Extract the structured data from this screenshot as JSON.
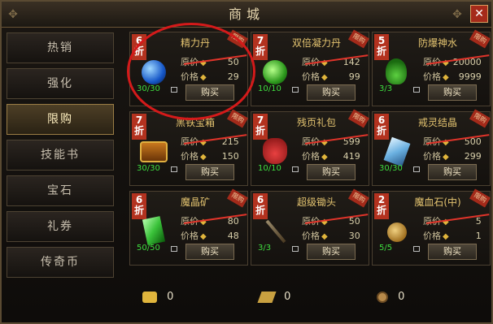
{
  "window": {
    "title": "商城",
    "close_label": "✕"
  },
  "sidebar": {
    "items": [
      {
        "label": "热销"
      },
      {
        "label": "强化"
      },
      {
        "label": "限购"
      },
      {
        "label": "技能书"
      },
      {
        "label": "宝石"
      },
      {
        "label": "礼券"
      },
      {
        "label": "传奇币"
      }
    ],
    "active_index": 2
  },
  "shop": {
    "price_orig_label": "原价",
    "price_now_label": "价格",
    "buy_label": "购买",
    "ribbon_label": "限购",
    "items": [
      {
        "name": "精力丹",
        "discount": "6",
        "discount_unit": "折",
        "orig_price": "50",
        "price": "29",
        "count": "30/30",
        "icon": "blue-orb-icon"
      },
      {
        "name": "双倍凝力丹",
        "discount": "7",
        "discount_unit": "折",
        "orig_price": "142",
        "price": "99",
        "count": "10/10",
        "icon": "green-orb-icon"
      },
      {
        "name": "防爆神水",
        "discount": "5",
        "discount_unit": "折",
        "orig_price": "20000",
        "price": "9999",
        "count": "3/3",
        "icon": "potion-icon"
      },
      {
        "name": "黑铁宝箱",
        "discount": "7",
        "discount_unit": "折",
        "orig_price": "215",
        "price": "150",
        "count": "30/30",
        "icon": "treasure-chest-icon"
      },
      {
        "name": "残页礼包",
        "discount": "7",
        "discount_unit": "折",
        "orig_price": "599",
        "price": "419",
        "count": "10/10",
        "icon": "gift-bag-icon"
      },
      {
        "name": "戒灵结晶",
        "discount": "6",
        "discount_unit": "折",
        "orig_price": "500",
        "price": "299",
        "count": "30/30",
        "icon": "crystal-icon"
      },
      {
        "name": "魔晶矿",
        "discount": "6",
        "discount_unit": "折",
        "orig_price": "80",
        "price": "48",
        "count": "50/50",
        "icon": "green-crystal-icon"
      },
      {
        "name": "超级锄头",
        "discount": "6",
        "discount_unit": "折",
        "orig_price": "50",
        "price": "30",
        "count": "3/3",
        "icon": "pickaxe-icon"
      },
      {
        "name": "魔血石(中)",
        "discount": "2",
        "discount_unit": "折",
        "orig_price": "5",
        "price": "1",
        "count": "5/5",
        "icon": "blood-stone-icon"
      }
    ]
  },
  "currencies": [
    {
      "icon": "gold-ingot-icon",
      "value": "0"
    },
    {
      "icon": "gold-bar-icon",
      "value": "0"
    },
    {
      "icon": "coin-icon",
      "value": "0"
    }
  ],
  "colors": {
    "badge": "#b3321f",
    "title": "#e4c470",
    "count": "#3fdc3f",
    "highlight_circle": "#d41a1a"
  }
}
